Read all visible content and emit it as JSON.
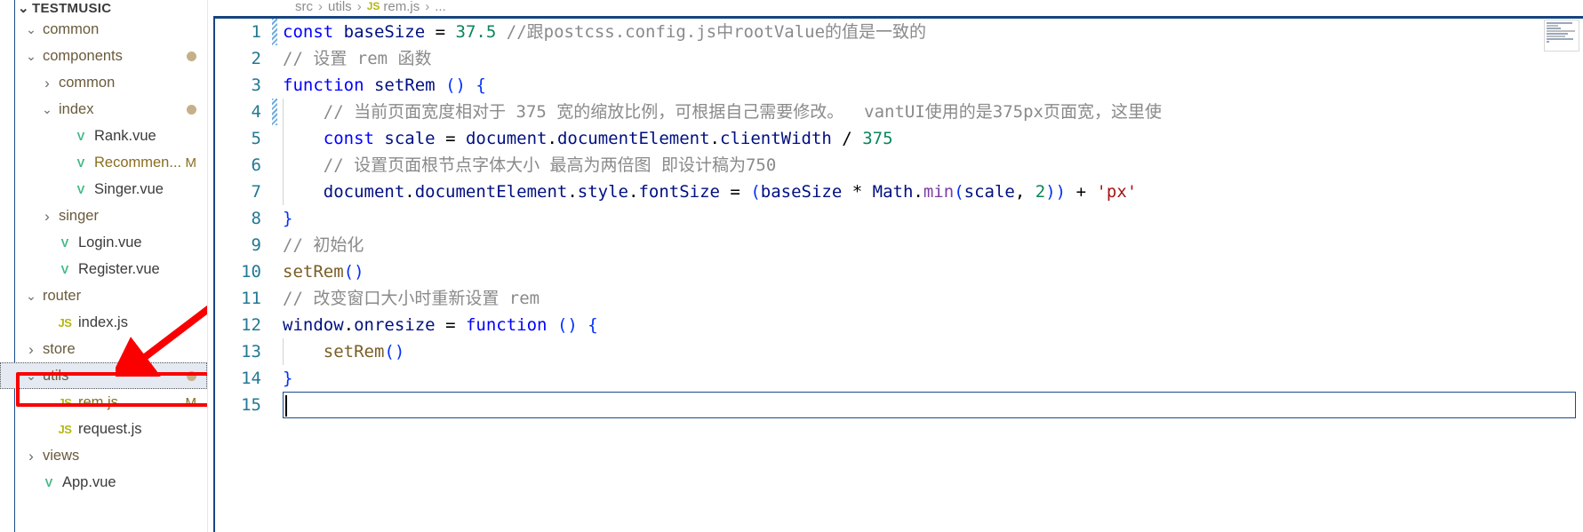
{
  "window": {
    "app": "Visual Studio Code",
    "theme_accent": "#17457f"
  },
  "sidebar": {
    "project_title": "TESTMUSIC",
    "items": [
      {
        "indent": 1,
        "twisty": "chevron-down-icon",
        "glyph": "∨",
        "label": "common",
        "kind": "folder",
        "icon": "",
        "badge": "",
        "dot": false,
        "selected": false
      },
      {
        "indent": 1,
        "twisty": "chevron-down-icon",
        "glyph": "∨",
        "label": "components",
        "kind": "folder",
        "icon": "",
        "badge": "",
        "dot": true,
        "selected": false
      },
      {
        "indent": 2,
        "twisty": "chevron-right-icon",
        "glyph": "›",
        "label": "common",
        "kind": "folder",
        "icon": "",
        "badge": "",
        "dot": false,
        "selected": false
      },
      {
        "indent": 2,
        "twisty": "chevron-down-icon",
        "glyph": "∨",
        "label": "index",
        "kind": "folder",
        "icon": "",
        "badge": "",
        "dot": true,
        "selected": false
      },
      {
        "indent": 3,
        "twisty": "",
        "glyph": "",
        "label": "Rank.vue",
        "kind": "file",
        "icon": "vue-icon",
        "badge": "",
        "dot": false,
        "selected": false
      },
      {
        "indent": 3,
        "twisty": "",
        "glyph": "",
        "label": "Recommen...",
        "kind": "file-modified",
        "icon": "vue-icon",
        "badge": "M",
        "dot": false,
        "selected": false
      },
      {
        "indent": 3,
        "twisty": "",
        "glyph": "",
        "label": "Singer.vue",
        "kind": "file",
        "icon": "vue-icon",
        "badge": "",
        "dot": false,
        "selected": false
      },
      {
        "indent": 2,
        "twisty": "chevron-right-icon",
        "glyph": "›",
        "label": "singer",
        "kind": "folder",
        "icon": "",
        "badge": "",
        "dot": false,
        "selected": false
      },
      {
        "indent": 2,
        "twisty": "",
        "glyph": "",
        "label": "Login.vue",
        "kind": "file",
        "icon": "vue-icon",
        "badge": "",
        "dot": false,
        "selected": false
      },
      {
        "indent": 2,
        "twisty": "",
        "glyph": "",
        "label": "Register.vue",
        "kind": "file",
        "icon": "vue-icon",
        "badge": "",
        "dot": false,
        "selected": false
      },
      {
        "indent": 1,
        "twisty": "chevron-down-icon",
        "glyph": "∨",
        "label": "router",
        "kind": "folder",
        "icon": "",
        "badge": "",
        "dot": false,
        "selected": false
      },
      {
        "indent": 2,
        "twisty": "",
        "glyph": "",
        "label": "index.js",
        "kind": "file",
        "icon": "js-icon",
        "badge": "",
        "dot": false,
        "selected": false
      },
      {
        "indent": 1,
        "twisty": "chevron-right-icon",
        "glyph": "›",
        "label": "store",
        "kind": "folder",
        "icon": "",
        "badge": "",
        "dot": false,
        "selected": false
      },
      {
        "indent": 1,
        "twisty": "chevron-down-icon",
        "glyph": "∨",
        "label": "utils",
        "kind": "folder",
        "icon": "",
        "badge": "",
        "dot": true,
        "selected": true
      },
      {
        "indent": 2,
        "twisty": "",
        "glyph": "",
        "label": "rem.js",
        "kind": "file-modified",
        "icon": "js-icon",
        "badge": "M",
        "dot": false,
        "selected": false
      },
      {
        "indent": 2,
        "twisty": "",
        "glyph": "",
        "label": "request.js",
        "kind": "file",
        "icon": "js-icon",
        "badge": "",
        "dot": false,
        "selected": false
      },
      {
        "indent": 1,
        "twisty": "chevron-right-icon",
        "glyph": "›",
        "label": "views",
        "kind": "folder",
        "icon": "",
        "badge": "",
        "dot": false,
        "selected": false
      },
      {
        "indent": 1,
        "twisty": "",
        "glyph": "",
        "label": "App.vue",
        "kind": "file",
        "icon": "vue-icon",
        "badge": "",
        "dot": false,
        "selected": false
      }
    ]
  },
  "breadcrumb": {
    "parts": [
      "src",
      "utils",
      "rem.js",
      "..."
    ],
    "separator": "›",
    "file_icon": "js-icon"
  },
  "editor": {
    "file": "rem.js",
    "language": "javascript",
    "active_line": 15,
    "lines": [
      {
        "n": "1",
        "changed": true,
        "indent": 0,
        "text": "const baseSize = 37.5 //跟postcss.config.js中rootValue的值是一致的"
      },
      {
        "n": "2",
        "changed": false,
        "indent": 0,
        "text": "// 设置 rem 函数"
      },
      {
        "n": "3",
        "changed": false,
        "indent": 0,
        "text": "function setRem () {"
      },
      {
        "n": "4",
        "changed": true,
        "indent": 1,
        "text": "// 当前页面宽度相对于 375 宽的缩放比例，可根据自己需要修改。  vantUI使用的是375px页面宽，这里使"
      },
      {
        "n": "5",
        "changed": false,
        "indent": 1,
        "text": "const scale = document.documentElement.clientWidth / 375"
      },
      {
        "n": "6",
        "changed": false,
        "indent": 1,
        "text": "// 设置页面根节点字体大小 最高为两倍图 即设计稿为750"
      },
      {
        "n": "7",
        "changed": false,
        "indent": 1,
        "text": "document.documentElement.style.fontSize = (baseSize * Math.min(scale, 2)) + 'px'"
      },
      {
        "n": "8",
        "changed": false,
        "indent": 0,
        "text": "}"
      },
      {
        "n": "9",
        "changed": false,
        "indent": 0,
        "text": "// 初始化"
      },
      {
        "n": "10",
        "changed": false,
        "indent": 0,
        "text": "setRem()"
      },
      {
        "n": "11",
        "changed": false,
        "indent": 0,
        "text": "// 改变窗口大小时重新设置 rem"
      },
      {
        "n": "12",
        "changed": false,
        "indent": 0,
        "text": "window.onresize = function () {"
      },
      {
        "n": "13",
        "changed": false,
        "indent": 1,
        "text": "setRem()"
      },
      {
        "n": "14",
        "changed": false,
        "indent": 0,
        "text": "}"
      },
      {
        "n": "15",
        "changed": false,
        "indent": 0,
        "text": ""
      }
    ]
  },
  "annotations": {
    "arrow": {
      "name": "red-arrow-annotation",
      "color": "#fa0000",
      "points_to": "utils"
    },
    "rect": {
      "name": "red-rectangle-annotation",
      "color": "#fa0000",
      "highlights": "rem.js"
    }
  },
  "minimap": {
    "name": "minimap",
    "visible": true
  }
}
